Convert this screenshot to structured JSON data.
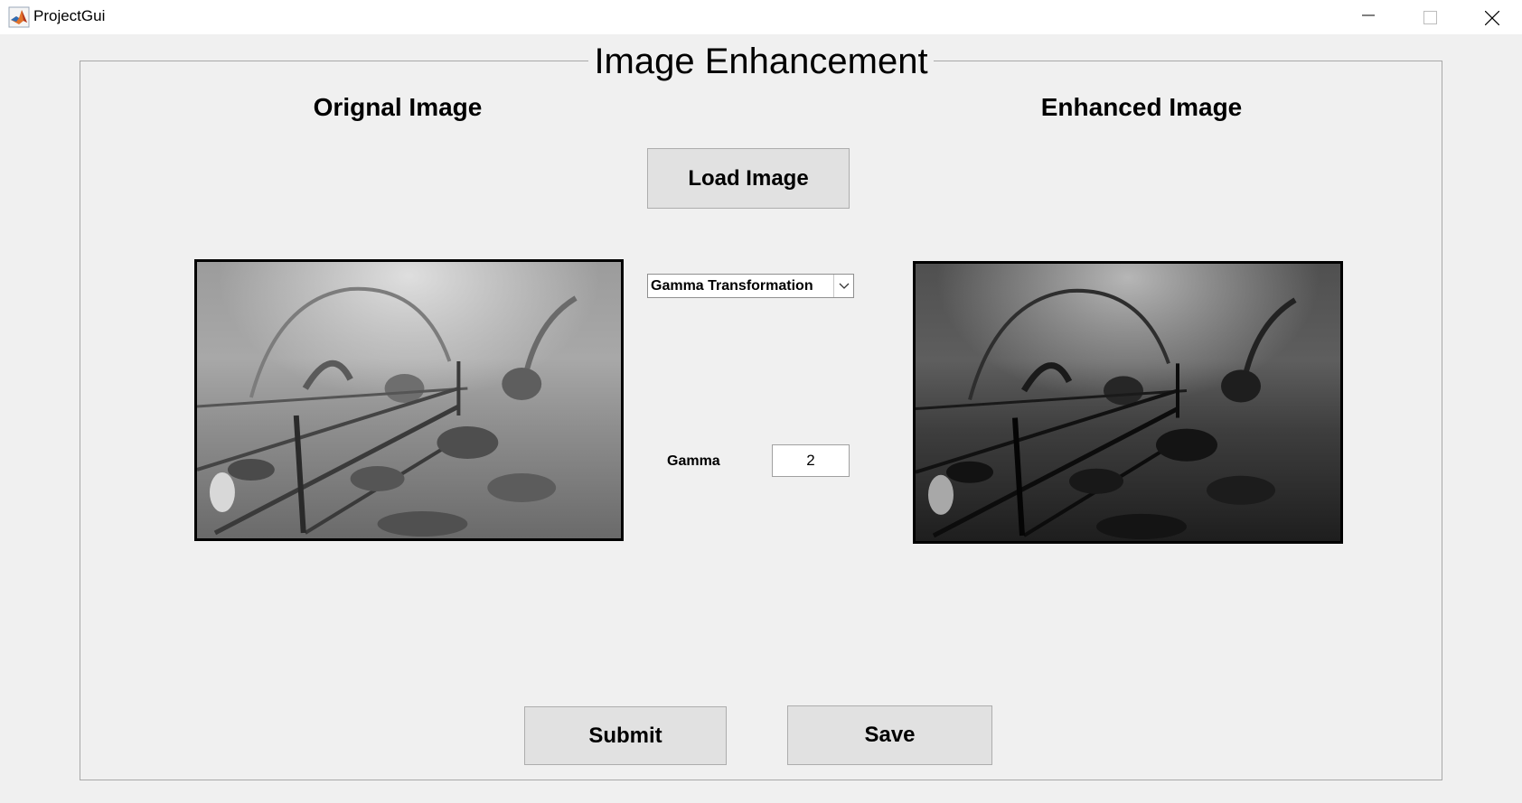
{
  "window": {
    "title": "ProjectGui"
  },
  "panel": {
    "title": "Image Enhancement"
  },
  "headings": {
    "original": "Orignal Image",
    "enhanced": "Enhanced Image"
  },
  "buttons": {
    "load": "Load Image",
    "submit": "Submit",
    "save": "Save"
  },
  "transform_select": {
    "selected": "Gamma Transformation"
  },
  "gamma": {
    "label": "Gamma",
    "value": "2"
  },
  "colors": {
    "background": "#f0f0f0",
    "button": "#e1e1e1",
    "panel_border": "#a8a8a8"
  },
  "icons": {
    "app": "matlab-icon",
    "minimize": "minimize-icon",
    "maximize": "maximize-icon",
    "close": "close-icon",
    "dropdown": "chevron-down-icon"
  }
}
